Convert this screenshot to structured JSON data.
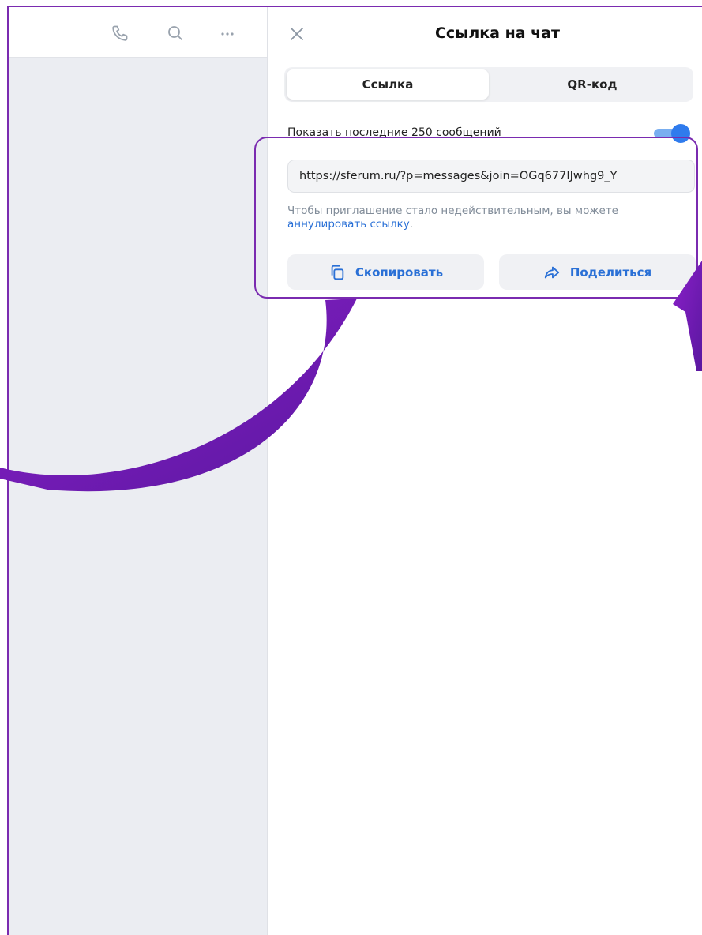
{
  "panel": {
    "title": "Ссылка на чат",
    "tabs": [
      {
        "label": "Ссылка",
        "active": true
      },
      {
        "label": "QR-код",
        "active": false
      }
    ],
    "toggle": {
      "label": "Показать последние 250 сообщений",
      "on": true
    },
    "link_value": "https://sferum.ru/?p=messages&join=OGq677IJwhg9_Y",
    "note_prefix": "Чтобы приглашение стало недействительным, вы можете ",
    "note_link": "аннулировать ссылку",
    "note_suffix": ".",
    "copy_label": "Скопировать",
    "share_label": "Поделиться"
  },
  "icons": {
    "header": [
      "phone-icon",
      "search-icon",
      "more-icon"
    ],
    "close": "close-icon",
    "copy": "copy-icon",
    "share": "share-icon"
  },
  "colors": {
    "accent": "#2a70d6",
    "toggle": "#2f7bed",
    "annotation": "#7a2bb0"
  }
}
